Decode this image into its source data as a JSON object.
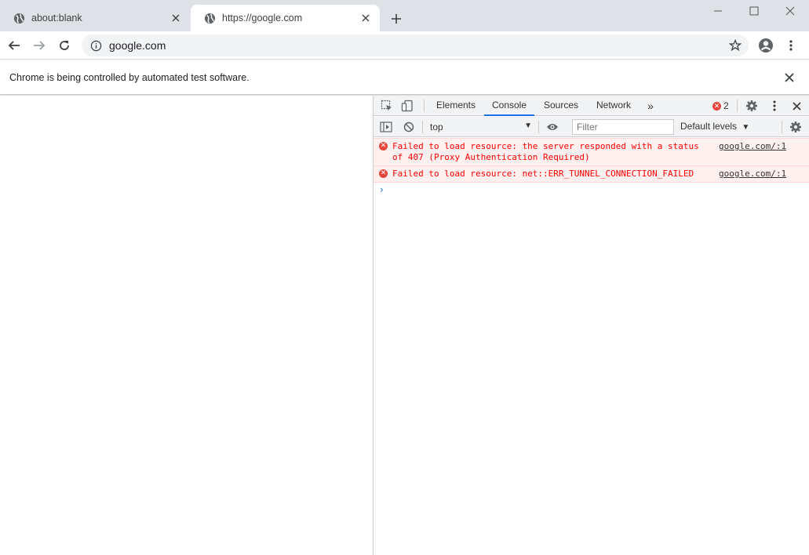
{
  "tabs": [
    {
      "title": "about:blank",
      "active": false
    },
    {
      "title": "https://google.com",
      "active": true
    }
  ],
  "toolbar": {
    "url": "google.com"
  },
  "infobar": {
    "message": "Chrome is being controlled by automated test software."
  },
  "devtools": {
    "tabs": [
      "Elements",
      "Console",
      "Sources",
      "Network"
    ],
    "active_tab": "Console",
    "error_count": "2",
    "context": "top",
    "filter_placeholder": "Filter",
    "levels": "Default levels",
    "messages": [
      {
        "level": "error",
        "text": "Failed to load resource: the server responded with a status of 407 (Proxy Authentication Required)",
        "source": "google.com/:1"
      },
      {
        "level": "error",
        "text": "Failed to load resource: net::ERR_TUNNEL_CONNECTION_FAILED",
        "source": "google.com/:1"
      }
    ]
  },
  "colors": {
    "accent": "#1a73e8",
    "error": "#fe0000",
    "error_bg": "#fff0f0",
    "tabstrip": "#dee1e6"
  }
}
